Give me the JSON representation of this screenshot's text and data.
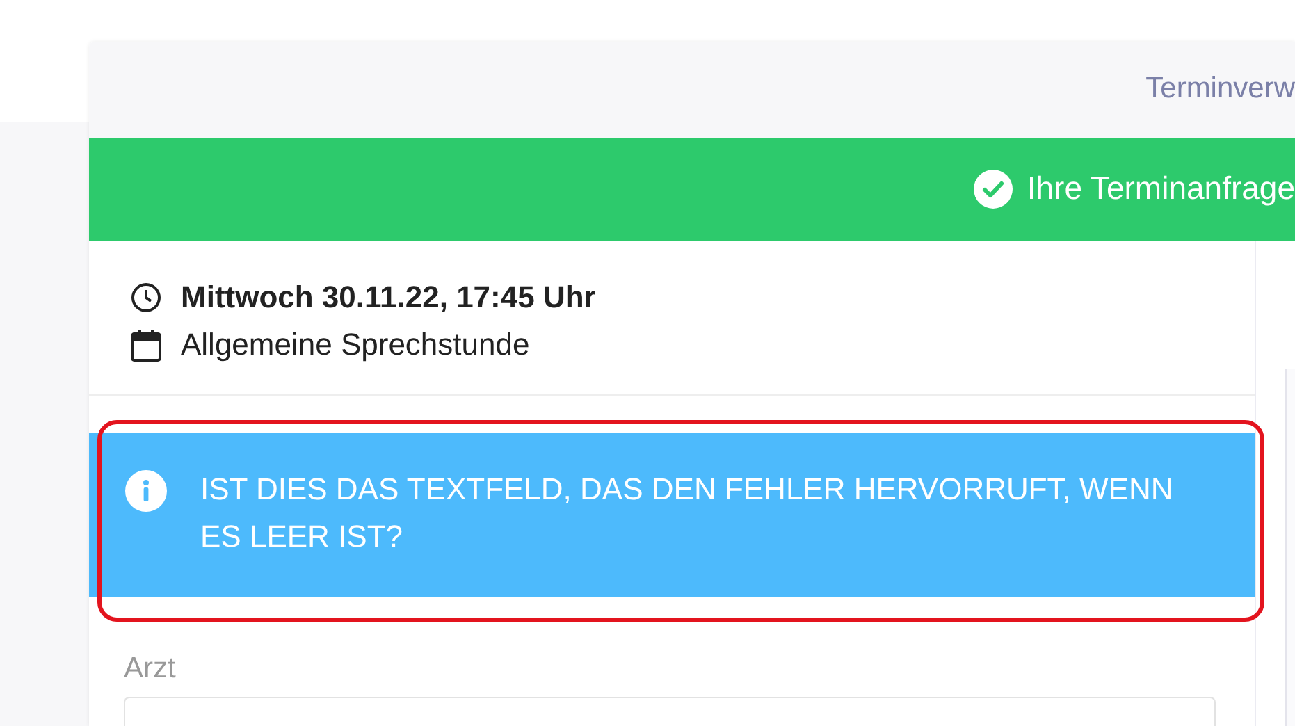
{
  "header": {
    "title": "Terminverw"
  },
  "banner": {
    "message": "Ihre Terminanfrage"
  },
  "appointment": {
    "datetime": "Mittwoch 30.11.22, 17:45 Uhr",
    "type": "Allgemeine Sprechstunde"
  },
  "info": {
    "message": "IST DIES DAS TEXTFELD, DAS DEN FEHLER HERVORRUFT, WENN ES LEER IST?"
  },
  "form": {
    "fields": [
      {
        "label": "Arzt"
      }
    ]
  }
}
